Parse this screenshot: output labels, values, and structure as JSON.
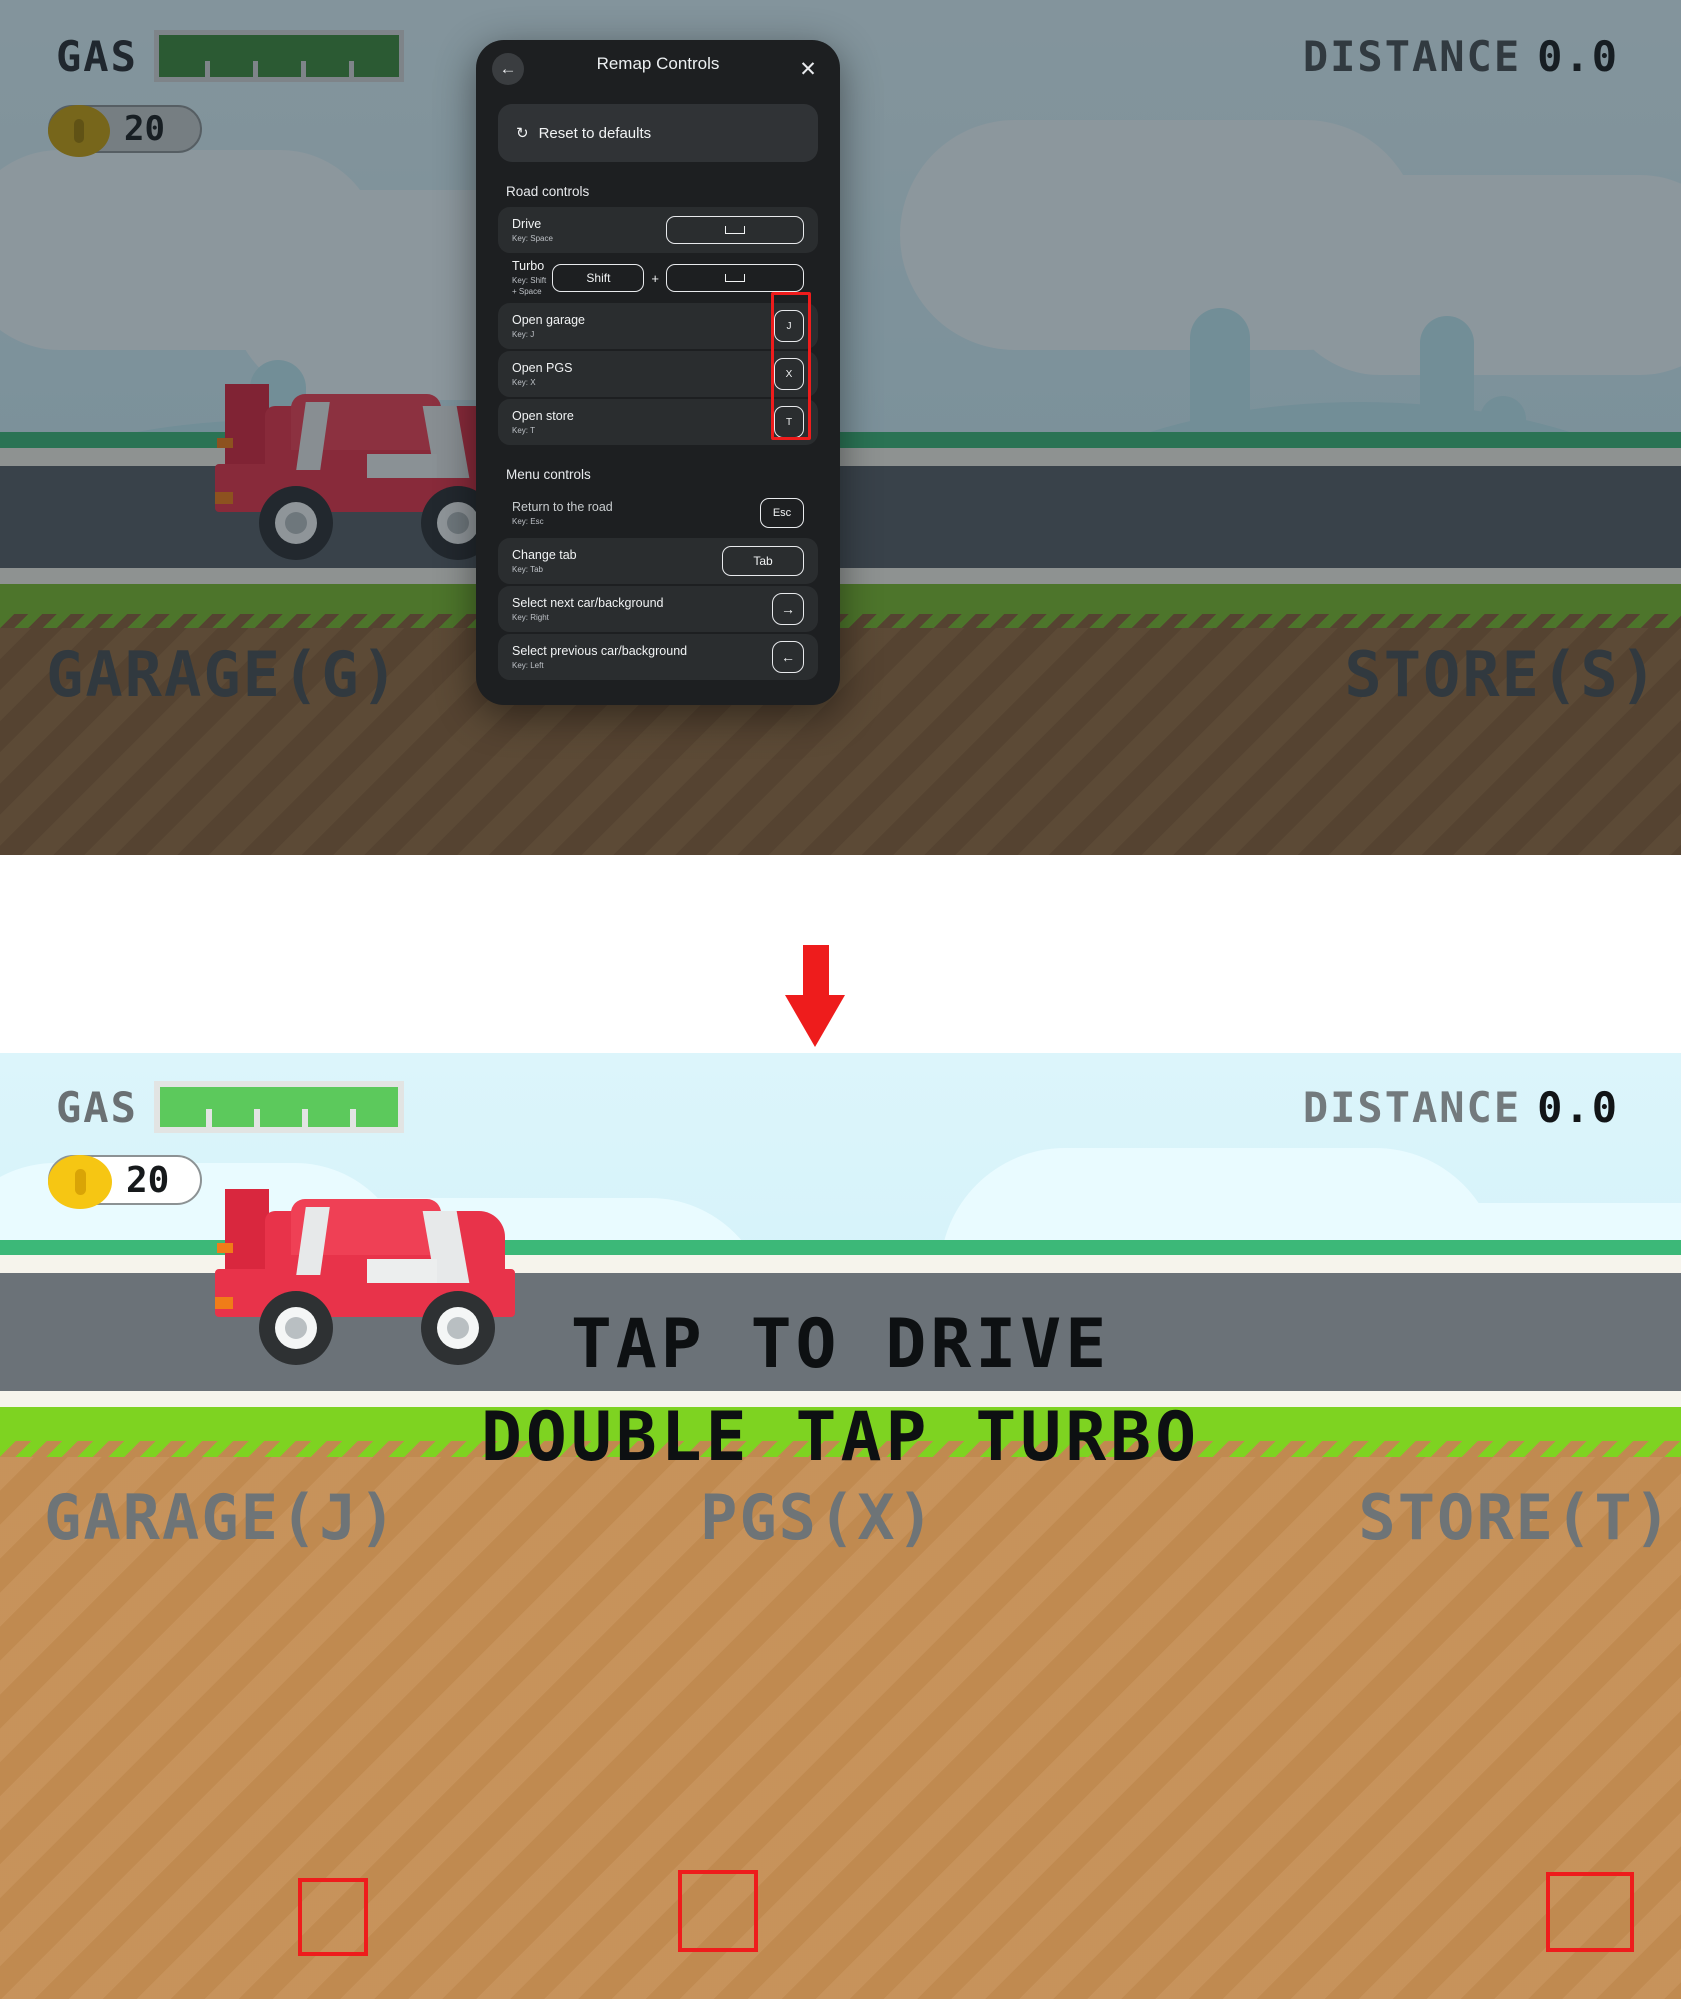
{
  "game": {
    "hud": {
      "gas_label": "GAS",
      "gas_percent": 100,
      "distance_label": "DISTANCE",
      "distance_value": "0.0",
      "coins": "20",
      "coin_icon": "coin-icon"
    },
    "tap_hint_line1": "TAP TO DRIVE",
    "tap_hint_line2": "DOUBLE TAP TURBO",
    "bottom_nav_before": [
      {
        "label": "GARAGE(G)",
        "key_part": "(G)"
      },
      {
        "label": "STORE(S)",
        "key_part": "(S)"
      }
    ],
    "bottom_nav_after": [
      {
        "label": "GARAGE(J)",
        "key_part": "(J)"
      },
      {
        "label": "PGS(X)",
        "key_part": "(X)"
      },
      {
        "label": "STORE(T)",
        "key_part": "(T)"
      }
    ],
    "colors": {
      "sky": "#cdeff7",
      "grass": "#6ec43f",
      "road": "#6b7278",
      "dirt": "#c08a50",
      "car_body": "#e8334a",
      "highlight": "#ee1c1c"
    }
  },
  "modal": {
    "title": "Remap Controls",
    "back_icon": "back-arrow-icon",
    "close_icon": "close-icon",
    "reset": {
      "icon": "reset-icon",
      "label": "Reset to defaults"
    },
    "sections": [
      {
        "title": "Road controls",
        "rows": [
          {
            "name": "Drive",
            "key_line": "Key: Space",
            "keys": [
              "space"
            ]
          },
          {
            "name": "Turbo",
            "key_line": "Key: Shift + Space",
            "keys": [
              "Shift",
              "+",
              "space"
            ]
          },
          {
            "name": "Open garage",
            "key_line": "Key: J",
            "keys": [
              "J"
            ]
          },
          {
            "name": "Open PGS",
            "key_line": "Key: X",
            "keys": [
              "X"
            ]
          },
          {
            "name": "Open store",
            "key_line": "Key: T",
            "keys": [
              "T"
            ]
          }
        ]
      },
      {
        "title": "Menu controls",
        "rows": [
          {
            "name": "Return to the road",
            "key_line": "Key: Esc",
            "keys": [
              "Esc"
            ]
          },
          {
            "name": "Change tab",
            "key_line": "Key: Tab",
            "keys": [
              "Tab"
            ]
          },
          {
            "name": "Select next car/background",
            "key_line": "Key: Right",
            "keys": [
              "→"
            ]
          },
          {
            "name": "Select previous car/background",
            "key_line": "Key: Left",
            "keys": [
              "←"
            ]
          }
        ]
      }
    ]
  },
  "annotation": {
    "arrow_icon": "down-arrow-annotation",
    "arrow_color": "#ee1c1c"
  }
}
